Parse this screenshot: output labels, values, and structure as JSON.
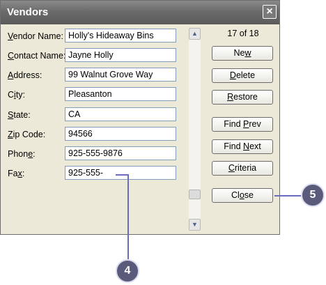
{
  "window": {
    "title": "Vendors",
    "close_glyph": "×"
  },
  "fields": [
    {
      "label": "Vendor Name:",
      "value": "Holly's Hideaway Bins"
    },
    {
      "label": "Contact Name:",
      "value": "Jayne Holly"
    },
    {
      "label": "Address:",
      "value": "99 Walnut Grove Way"
    },
    {
      "label": "City:",
      "value": "Pleasanton"
    },
    {
      "label": "State:",
      "value": "CA"
    },
    {
      "label": "Zip Code:",
      "value": "94566"
    },
    {
      "label": "Phone:",
      "value": "925-555-9876"
    },
    {
      "label": "Fax:",
      "value": "925-555-"
    }
  ],
  "record_counter": "17 of 18",
  "buttons": {
    "new": "New",
    "delete": "Delete",
    "restore": "Restore",
    "find_prev": "Find Prev",
    "find_next": "Find Next",
    "criteria": "Criteria",
    "close": "Close"
  },
  "scrollbar": {
    "up_icon": "chevron-up-icon",
    "down_icon": "chevron-down-icon"
  },
  "callouts": {
    "c4": "4",
    "c5": "5"
  },
  "colors": {
    "callout_fill": "#5a5a7a",
    "callout_line": "#6b6bc0",
    "titlebar": "#6b6b6b"
  }
}
